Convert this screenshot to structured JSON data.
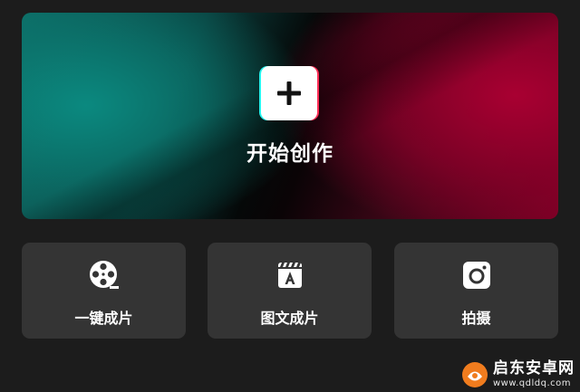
{
  "hero": {
    "label": "开始创作",
    "icon": "plus-icon"
  },
  "tools": [
    {
      "label": "一键成片",
      "icon": "film-reel-icon"
    },
    {
      "label": "图文成片",
      "icon": "clapperboard-text-icon"
    },
    {
      "label": "拍摄",
      "icon": "camera-icon"
    }
  ],
  "watermark": {
    "title": "启东安卓网",
    "url": "www.qdldq.com"
  },
  "colors": {
    "background": "#1c1c1c",
    "card": "#343434",
    "accent_cyan": "#25f4ee",
    "accent_red": "#fe2c55",
    "watermark_orange": "#f07c1e"
  }
}
